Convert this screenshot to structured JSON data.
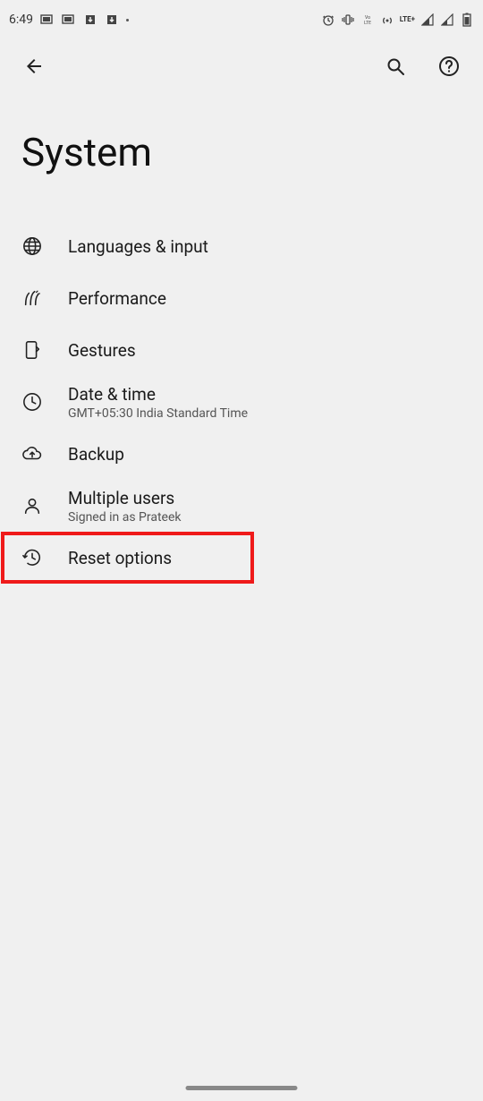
{
  "status": {
    "time": "6:49",
    "lte": "LTE+"
  },
  "page": {
    "title": "System"
  },
  "items": {
    "languages": {
      "label": "Languages & input"
    },
    "performance": {
      "label": "Performance"
    },
    "gestures": {
      "label": "Gestures"
    },
    "datetime": {
      "label": "Date & time",
      "sub": "GMT+05:30 India Standard Time"
    },
    "backup": {
      "label": "Backup"
    },
    "users": {
      "label": "Multiple users",
      "sub": "Signed in as Prateek"
    },
    "reset": {
      "label": "Reset options"
    }
  }
}
